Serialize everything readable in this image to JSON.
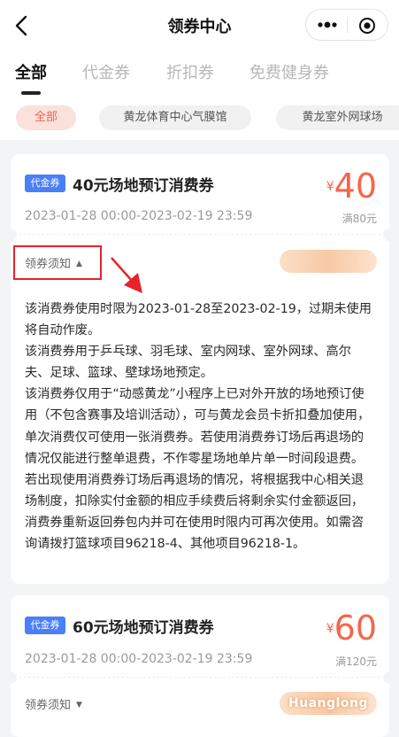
{
  "header": {
    "title": "领券中心"
  },
  "tabs": [
    {
      "label": "全部",
      "active": true
    },
    {
      "label": "代金券",
      "active": false
    },
    {
      "label": "折扣券",
      "active": false
    },
    {
      "label": "免费健身券",
      "active": false
    }
  ],
  "filters": [
    {
      "label": "全部",
      "active": true
    },
    {
      "label": "黄龙体育中心气膜馆",
      "active": false
    },
    {
      "label": "黄龙室外网球场",
      "active": false
    }
  ],
  "coupons": [
    {
      "badge": "代金券",
      "title": "40元场地预订消费券",
      "currency": "¥",
      "amount": "40",
      "condition": "满80元",
      "validity": "2023-01-28 00:00-2023-02-19 23:59",
      "notice_label": "领券须知",
      "notice_expanded": true,
      "terms": [
        "该消费券使用时限为2023-01-28至2023-02-19，过期未使用将自动作废。",
        "该消费券用于乒乓球、羽毛球、室内网球、室外网球、高尔夫、足球、篮球、壁球场地预定。",
        "该消费券仅用于“动感黄龙”小程序上已对外开放的场地预订使用（不包含赛事及培训活动），可与黄龙会员卡折扣叠加使用，单次消费仅可使用一张消费券。若使用消费券订场后再退场的情况仅能进行整单退费，不作零星场地单片单一时间段退费。若出现使用消费券订场后再退场的情况，将根据我中心相关退场制度，扣除实付金额的相应手续费后将剩余实付金额返回，消费券重新返回券包内并可在使用时限内可再次使用。如需咨询请拨打篮球项目96218-4、其他项目96218-1。"
      ]
    },
    {
      "badge": "代金券",
      "title": "60元场地预订消费券",
      "currency": "¥",
      "amount": "60",
      "condition": "满120元",
      "validity": "2023-01-28 00:00-2023-02-19 23:59",
      "notice_label": "领券须知",
      "notice_expanded": false,
      "watermark": "Huanglong"
    }
  ],
  "colors": {
    "accent": "#f4664a",
    "badge": "#4a7ff7",
    "annotation": "#e8222b"
  }
}
